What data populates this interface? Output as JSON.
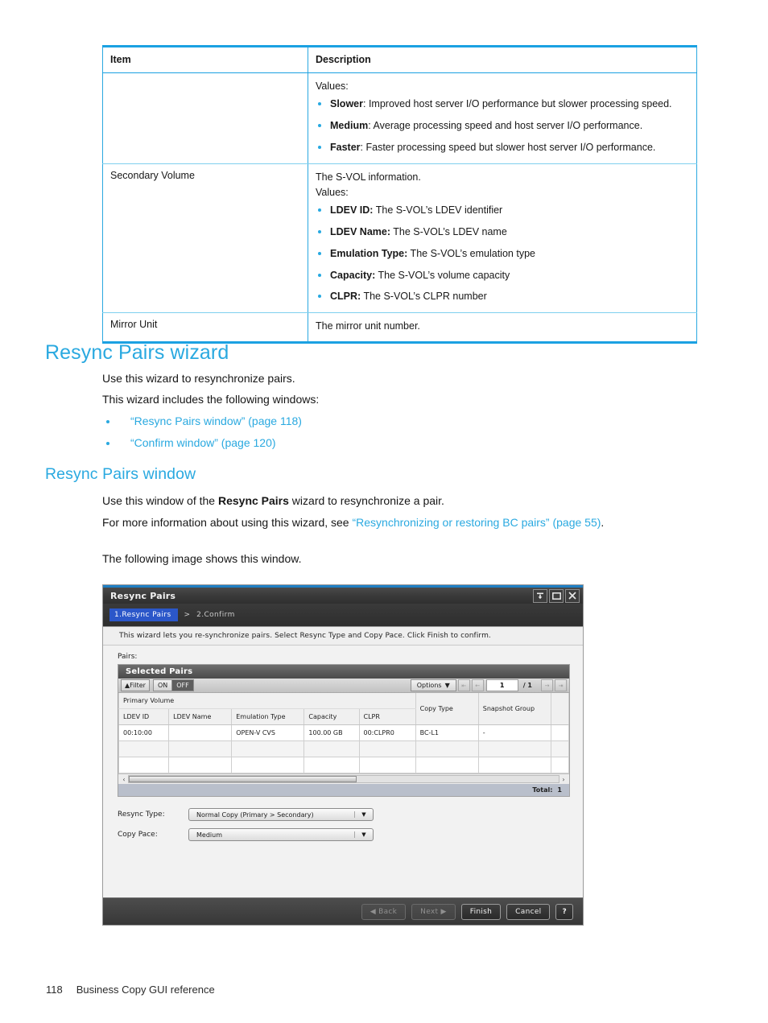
{
  "reference_table": {
    "headers": [
      "Item",
      "Description"
    ],
    "rows": [
      {
        "item": "",
        "desc_lines": [
          "Values:"
        ],
        "bullets": [
          {
            "term": "Slower",
            "sep": ":",
            "text": " Improved host server I/O performance but slower processing speed."
          },
          {
            "term": "Medium",
            "sep": ":",
            "text": " Average processing speed and host server I/O performance."
          },
          {
            "term": "Faster",
            "sep": ":",
            "text": " Faster processing speed but slower host server I/O performance."
          }
        ]
      },
      {
        "item": "Secondary Volume",
        "desc_lines": [
          "The S-VOL information.",
          "Values:"
        ],
        "bullets": [
          {
            "term": "LDEV ID:",
            "sep": "",
            "text": " The S-VOL’s LDEV identifier"
          },
          {
            "term": "LDEV Name:",
            "sep": "",
            "text": " The S-VOL’s LDEV name"
          },
          {
            "term": "Emulation Type:",
            "sep": "",
            "text": " The S-VOL’s emulation type"
          },
          {
            "term": "Capacity:",
            "sep": "",
            "text": " The S-VOL’s volume capacity"
          },
          {
            "term": "CLPR:",
            "sep": "",
            "text": " The S-VOL’s CLPR number"
          }
        ]
      },
      {
        "item": "Mirror Unit",
        "desc_lines": [
          "The mirror unit number."
        ],
        "bullets": []
      }
    ]
  },
  "section": {
    "heading": "Resync Pairs wizard",
    "para1": "Use this wizard to resynchronize pairs.",
    "para2": "This wizard includes the following windows:",
    "links": [
      "“Resync Pairs window” (page 118)",
      "“Confirm window” (page 120)"
    ]
  },
  "subsection": {
    "heading": "Resync Pairs window",
    "para1_a": "Use this window of the ",
    "para1_bold": "Resync Pairs",
    "para1_b": " wizard to resynchronize a pair.",
    "para2_a": "For more information about using this wizard, see ",
    "para2_link": "“Resynchronizing or restoring BC pairs” (page 55)",
    "para2_b": ".",
    "para3": "The following image shows this window."
  },
  "dialog": {
    "title": "Resync Pairs",
    "window_buttons": [
      "collapse-icon",
      "maximize-icon",
      "close-icon"
    ],
    "steps": {
      "current": "1.Resync Pairs",
      "separator": ">",
      "next": "2.Confirm"
    },
    "instruction": "This wizard lets you re-synchronize pairs. Select Resync Type and Copy Pace. Click Finish to confirm.",
    "pairs_label": "Pairs:",
    "panel": {
      "title": "Selected Pairs",
      "filter_button": "Filter",
      "toggle": {
        "on": "ON",
        "off": "OFF",
        "selected": "OFF"
      },
      "options_button": "Options",
      "pagination": {
        "current": "1",
        "separator": "/ 1"
      }
    },
    "table": {
      "group_header": "Primary Volume",
      "columns": [
        "LDEV ID",
        "LDEV Name",
        "Emulation Type",
        "Capacity",
        "CLPR"
      ],
      "extra_columns": [
        "Copy Type",
        "Snapshot Group"
      ],
      "rows": [
        {
          "ldev_id": "00:10:00",
          "ldev_name": "",
          "emulation_type": "OPEN-V CVS",
          "capacity": "100.00 GB",
          "clpr": "00:CLPR0",
          "copy_type": "BC-L1",
          "snapshot_group": "-"
        }
      ],
      "empty_rows": 2,
      "total_label": "Total:",
      "total_value": "1"
    },
    "fields": [
      {
        "label": "Resync Type:",
        "value": "Normal Copy (Primary > Secondary)"
      },
      {
        "label": "Copy Pace:",
        "value": "Medium"
      }
    ],
    "footer_buttons": [
      {
        "label": "Back",
        "state": "disabled",
        "icon": "left-arrow"
      },
      {
        "label": "Next",
        "state": "disabled",
        "icon": "right-arrow"
      },
      {
        "label": "Finish",
        "state": "enabled",
        "icon": ""
      },
      {
        "label": "Cancel",
        "state": "enabled",
        "icon": ""
      },
      {
        "label": "?",
        "state": "enabled",
        "icon": "help"
      }
    ]
  },
  "page_footer": {
    "page_number": "118",
    "title": "Business Copy GUI reference"
  },
  "colors": {
    "accent_blue": "#2aa9e0",
    "table_border": "#1ba1e2",
    "step_active": "#2b57c9",
    "total_bar": "#b9bfcb"
  }
}
